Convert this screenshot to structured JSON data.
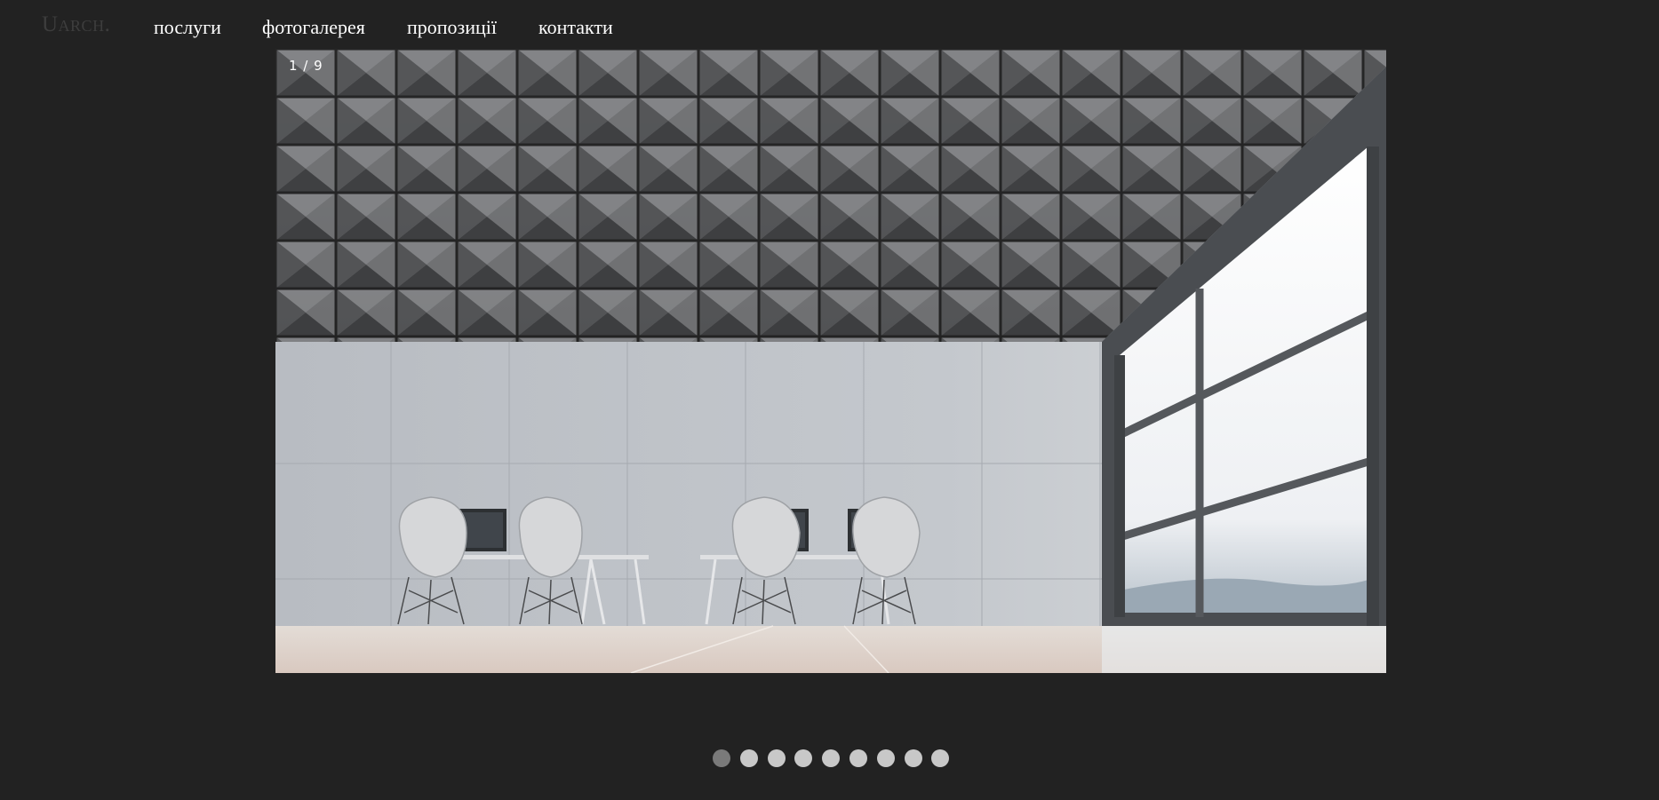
{
  "nav": {
    "logo": "Uarch.",
    "links": [
      "послуги",
      "фотогалерея",
      "пропозиції",
      "контакти"
    ]
  },
  "slider": {
    "counter": "1 / 9",
    "current": 1,
    "total": 9,
    "active_dot_color": "#7a7a7a",
    "dot_color": "#c8c8c8"
  },
  "colors": {
    "background": "#222222",
    "nav_text": "#ffffff",
    "logo": "#3d3d3d"
  }
}
